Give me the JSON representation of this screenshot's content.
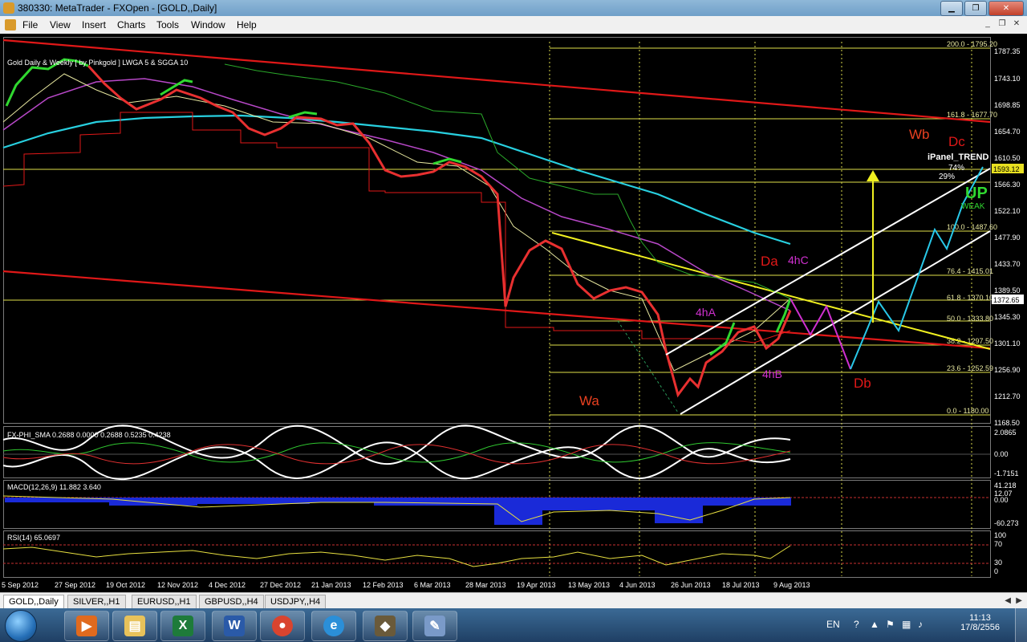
{
  "window": {
    "title": "380330: MetaTrader - FXOpen - [GOLD,,Daily]"
  },
  "menu": [
    "File",
    "View",
    "Insert",
    "Charts",
    "Tools",
    "Window",
    "Help"
  ],
  "chart": {
    "header": "Gold Daily & Weekly [ by Pinkgold ] LWGA 5 & SGGA 10",
    "current_price": "1372.65",
    "price_high_box": "1593.12",
    "price_scale": [
      "1787.35",
      "1743.10",
      "1698.85",
      "1654.70",
      "1610.50",
      "1566.30",
      "1522.10",
      "1477.90",
      "1433.70",
      "1389.50",
      "1345.30",
      "1301.10",
      "1256.90",
      "1212.70",
      "1168.50"
    ],
    "date_axis": [
      "5 Sep 2012",
      "27 Sep 2012",
      "19 Oct 2012",
      "12 Nov 2012",
      "4 Dec 2012",
      "27 Dec 2012",
      "21 Jan 2013",
      "12 Feb 2013",
      "6 Mar 2013",
      "28 Mar 2013",
      "19 Apr 2013",
      "13 May 2013",
      "4 Jun 2013",
      "26 Jun 2013",
      "18 Jul 2013",
      "9 Aug 2013"
    ],
    "fib_levels": [
      {
        "label": "200.0 - 1795.20"
      },
      {
        "label": "161.8 - 1677.70"
      },
      {
        "label": "100.0 - 1487.60"
      },
      {
        "label": "76.4 - 1415.01"
      },
      {
        "label": "61.8 - 1370.10"
      },
      {
        "label": "50.0 - 1333.80"
      },
      {
        "label": "38.2 - 1297.50"
      },
      {
        "label": "23.6 - 1252.59"
      },
      {
        "label": "0.0 - 1180.00"
      }
    ],
    "wave_labels": {
      "wa": "Wa",
      "wb": "Wb",
      "dc": "Dc",
      "da": "Da",
      "db": "Db",
      "h4a": "4hA",
      "h4b": "4hB",
      "h4c": "4hC"
    },
    "ipanel": {
      "title": "iPanel_TREND",
      "pct1": "74%",
      "pct2": "29%",
      "direction": "UP",
      "strength": "WEAK"
    },
    "fx_indicator": {
      "header": "FX-PHI_SMA 0.2688 0.0000 0.2688 0.5235 0.4238",
      "scale": [
        "2.0865",
        "0.00",
        "-1.7151"
      ]
    },
    "macd": {
      "header": "MACD(12,26,9) 11.882 3.640",
      "scale": [
        "41.218",
        "12.07",
        "0.00",
        "-60.273"
      ]
    },
    "rsi": {
      "header": "RSI(14) 65.0697",
      "scale": [
        "100",
        "70",
        "30",
        "0"
      ]
    }
  },
  "tabs": [
    "GOLD,,Daily",
    "SILVER,,H1",
    "EURUSD,,H1",
    "GBPUSD,,H4",
    "USDJPY,,H4"
  ],
  "taskbar": {
    "lang": "EN",
    "time": "11:13",
    "date": "17/8/2556",
    "apps": [
      {
        "name": "media-player-icon",
        "color": "#e06a1e",
        "glyph": "▶"
      },
      {
        "name": "folder-icon",
        "color": "#e8c25a",
        "glyph": "▤"
      },
      {
        "name": "excel-icon",
        "color": "#1e7b3a",
        "glyph": "X"
      },
      {
        "name": "word-icon",
        "color": "#2a5aa8",
        "glyph": "W"
      },
      {
        "name": "chrome-icon",
        "color": "#d9442f",
        "glyph": "●"
      },
      {
        "name": "ie-icon",
        "color": "#2b8fd8",
        "glyph": "e"
      },
      {
        "name": "metatrader-icon",
        "color": "#6a5a3a",
        "glyph": "◆"
      },
      {
        "name": "paint-icon",
        "color": "#7a9ac8",
        "glyph": "✎"
      }
    ]
  }
}
